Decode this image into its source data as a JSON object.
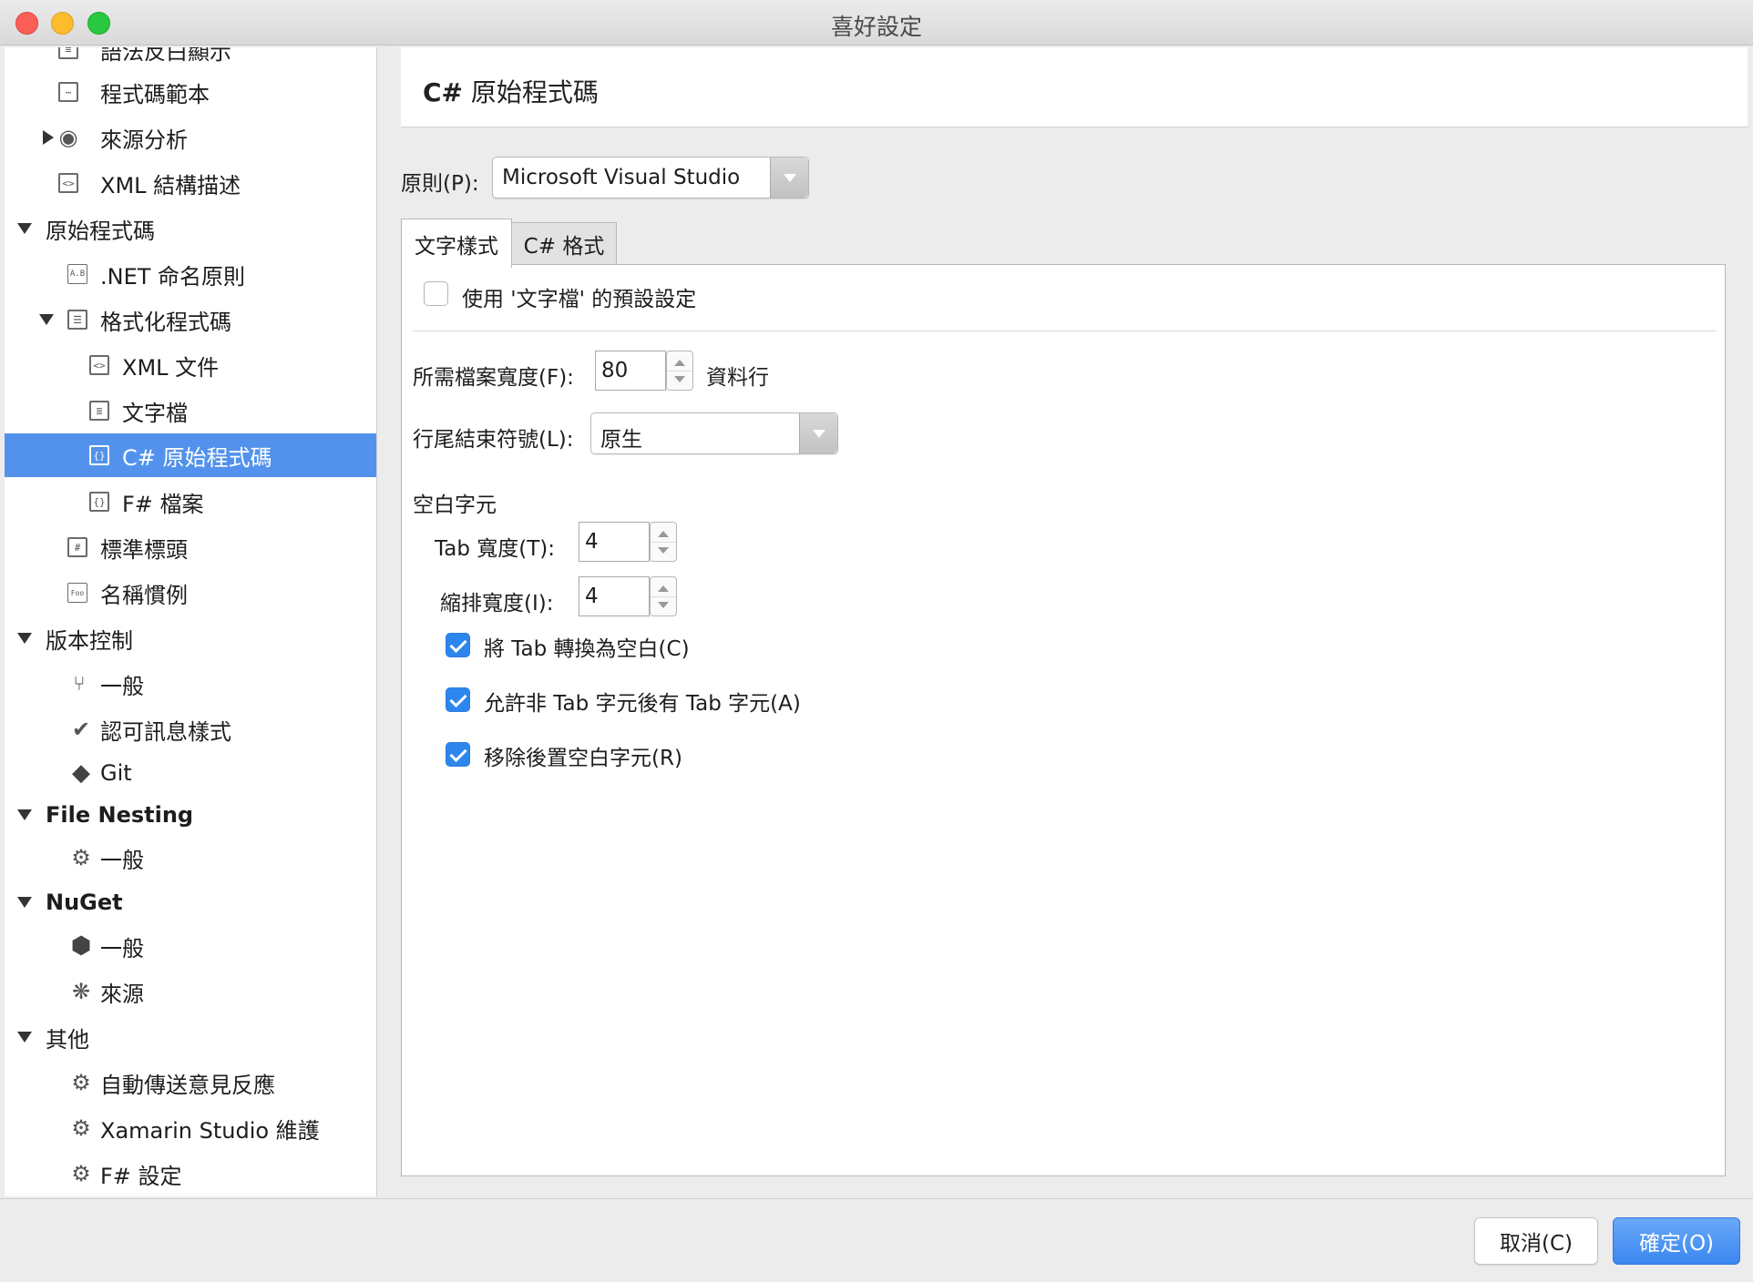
{
  "window": {
    "title": "喜好設定"
  },
  "sidebar": {
    "items": [
      {
        "label": "語法反白顯示",
        "icon": "syntax-icon"
      },
      {
        "label": "程式碼範本",
        "icon": "snippet-icon"
      },
      {
        "label": "來源分析",
        "icon": "analysis-icon"
      },
      {
        "label": "XML 結構描述",
        "icon": "xml-schema-icon"
      },
      {
        "label": "原始程式碼"
      },
      {
        "label": ".NET 命名原則",
        "icon": "naming-icon"
      },
      {
        "label": "格式化程式碼",
        "icon": "format-icon"
      },
      {
        "label": "XML 文件",
        "icon": "xml-file-icon"
      },
      {
        "label": "文字檔",
        "icon": "text-file-icon"
      },
      {
        "label": "C# 原始程式碼",
        "icon": "csharp-file-icon"
      },
      {
        "label": "F# 檔案",
        "icon": "fsharp-file-icon"
      },
      {
        "label": "標準標頭",
        "icon": "header-icon"
      },
      {
        "label": "名稱慣例",
        "icon": "name-convention-icon"
      },
      {
        "label": "版本控制"
      },
      {
        "label": "一般",
        "icon": "branch-icon"
      },
      {
        "label": "認可訊息樣式",
        "icon": "check-circle-icon"
      },
      {
        "label": "Git",
        "icon": "git-icon"
      },
      {
        "label": "File Nesting"
      },
      {
        "label": "一般",
        "icon": "gear-icon"
      },
      {
        "label": "NuGet"
      },
      {
        "label": "一般",
        "icon": "package-icon"
      },
      {
        "label": "來源",
        "icon": "sources-icon"
      },
      {
        "label": "其他"
      },
      {
        "label": "自動傳送意見反應",
        "icon": "gear-icon"
      },
      {
        "label": "Xamarin Studio 維護",
        "icon": "gear-icon"
      },
      {
        "label": "F# 設定",
        "icon": "gear-icon"
      }
    ]
  },
  "main": {
    "title_prefix": "C#",
    "title_rest": " 原始程式碼",
    "policy_label": "原則(P):",
    "policy_value": "Microsoft Visual Studio",
    "tabs": [
      {
        "label": "文字樣式"
      },
      {
        "label": "C# 格式"
      }
    ],
    "use_default_label": "使用 '文字檔' 的預設設定",
    "file_width_label": "所需檔案寬度(F):",
    "file_width_value": "80",
    "file_width_unit": "資料行",
    "line_ending_label": "行尾結束符號(L):",
    "line_ending_value": "原生",
    "whitespace_heading": "空白字元",
    "tab_width_label": "Tab 寬度(T):",
    "tab_width_value": "4",
    "indent_width_label": "縮排寬度(I):",
    "indent_width_value": "4",
    "convert_tabs_label": "將 Tab 轉換為空白(C)",
    "allow_tabs_label": "允許非 Tab 字元後有 Tab 字元(A)",
    "remove_trailing_label": "移除後置空白字元(R)"
  },
  "footer": {
    "cancel_label": "取消(C)",
    "ok_label": "確定(O)"
  },
  "colors": {
    "selection": "#5292ec",
    "checkbox": "#2d86ed",
    "ok_button": "#3a87f0"
  }
}
